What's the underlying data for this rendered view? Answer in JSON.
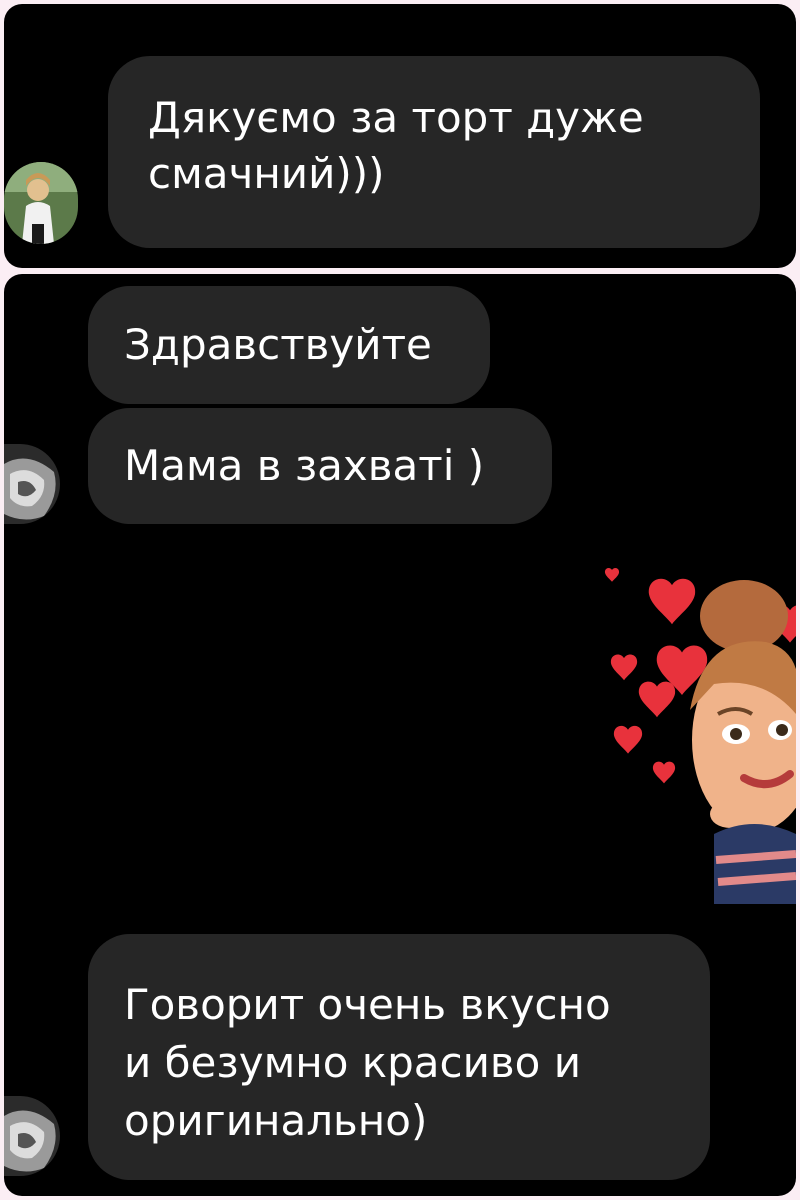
{
  "chat_top": {
    "messages": [
      {
        "text_lines": [
          "Дякуємо за торт дуже",
          "смачний)))"
        ]
      }
    ],
    "avatar_icon": "user-avatar-photo-woman"
  },
  "chat_bottom": {
    "messages": [
      {
        "text": "Здравствуйте"
      },
      {
        "text": "Мама в захваті )"
      },
      {
        "text_lines": [
          "Говорит очень вкусно",
          "и безумно красиво и",
          "оригинально)"
        ]
      }
    ],
    "avatar_icon": "user-avatar-bw-photo",
    "sticker_icon": "avatar-sticker-hearts"
  },
  "colors": {
    "background": "#fbeef4",
    "panel": "#000000",
    "bubble": "#262626",
    "text": "#ffffff",
    "heart": "#e8323c"
  }
}
